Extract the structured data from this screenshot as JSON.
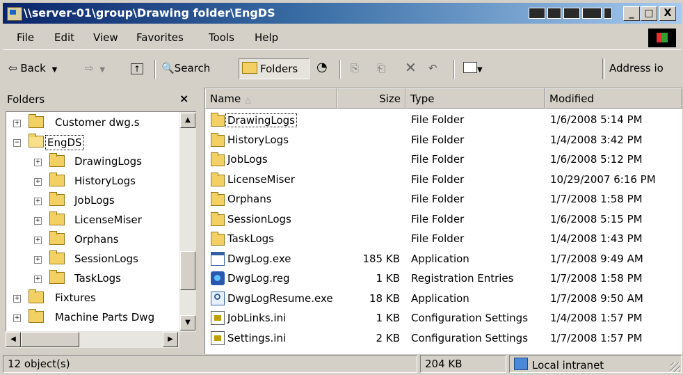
{
  "window": {
    "title": "\\\\server-01\\group\\Drawing folder\\EngDS",
    "buttons": {
      "minimize": "_",
      "maximize": "□",
      "close": "X"
    }
  },
  "menu": [
    "File",
    "Edit",
    "View",
    "Favorites",
    "Tools",
    "Help"
  ],
  "toolbar": {
    "back_label": "Back",
    "search_label": "Search",
    "folders_label": "Folders",
    "address_label": "Address io"
  },
  "folders_pane": {
    "title": "Folders",
    "close": "×",
    "tree": [
      {
        "label": "Customer dwg.s",
        "expander": "+"
      },
      {
        "label": "EngDS",
        "expander": "−"
      },
      {
        "label": "DrawingLogs",
        "expander": "+"
      },
      {
        "label": "HistoryLogs",
        "expander": "+"
      },
      {
        "label": "JobLogs",
        "expander": "+"
      },
      {
        "label": "LicenseMiser",
        "expander": "+"
      },
      {
        "label": "Orphans",
        "expander": "+"
      },
      {
        "label": "SessionLogs",
        "expander": "+"
      },
      {
        "label": "TaskLogs",
        "expander": "+"
      },
      {
        "label": "Fixtures",
        "expander": "+"
      },
      {
        "label": "Machine Parts Dwg",
        "expander": "+"
      }
    ]
  },
  "columns": {
    "name": "Name",
    "size": "Size",
    "type": "Type",
    "modified": "Modified"
  },
  "files": [
    {
      "name": "DrawingLogs",
      "size": "",
      "type": "File Folder",
      "modified": "1/6/2008 5:14 PM",
      "icon": "folder-icon"
    },
    {
      "name": "HistoryLogs",
      "size": "",
      "type": "File Folder",
      "modified": "1/4/2008 3:42 PM",
      "icon": "folder-icon"
    },
    {
      "name": "JobLogs",
      "size": "",
      "type": "File Folder",
      "modified": "1/6/2008 5:12 PM",
      "icon": "folder-icon"
    },
    {
      "name": "LicenseMiser",
      "size": "",
      "type": "File Folder",
      "modified": "10/29/2007 6:16 PM",
      "icon": "folder-icon"
    },
    {
      "name": "Orphans",
      "size": "",
      "type": "File Folder",
      "modified": "1/7/2008 1:58 PM",
      "icon": "folder-icon"
    },
    {
      "name": "SessionLogs",
      "size": "",
      "type": "File Folder",
      "modified": "1/6/2008 5:15 PM",
      "icon": "folder-icon"
    },
    {
      "name": "TaskLogs",
      "size": "",
      "type": "File Folder",
      "modified": "1/4/2008 1:43 PM",
      "icon": "folder-icon"
    },
    {
      "name": "DwgLog.exe",
      "size": "185 KB",
      "type": "Application",
      "modified": "1/7/2008 9:49 AM",
      "icon": "exe-icon"
    },
    {
      "name": "DwgLog.reg",
      "size": "1 KB",
      "type": "Registration Entries",
      "modified": "1/7/2008 1:58 PM",
      "icon": "registry-icon"
    },
    {
      "name": "DwgLogResume.exe",
      "size": "18 KB",
      "type": "Application",
      "modified": "1/7/2008 9:50 AM",
      "icon": "application-window-icon"
    },
    {
      "name": "JobLinks.ini",
      "size": "1 KB",
      "type": "Configuration Settings",
      "modified": "1/4/2008 1:57 PM",
      "icon": "settings-file-icon"
    },
    {
      "name": "Settings.ini",
      "size": "2 KB",
      "type": "Configuration Settings",
      "modified": "1/7/2008 1:57 PM",
      "icon": "settings-file-icon"
    }
  ],
  "status": {
    "objects": "12 object(s)",
    "size": "204 KB",
    "zone": "Local intranet"
  }
}
